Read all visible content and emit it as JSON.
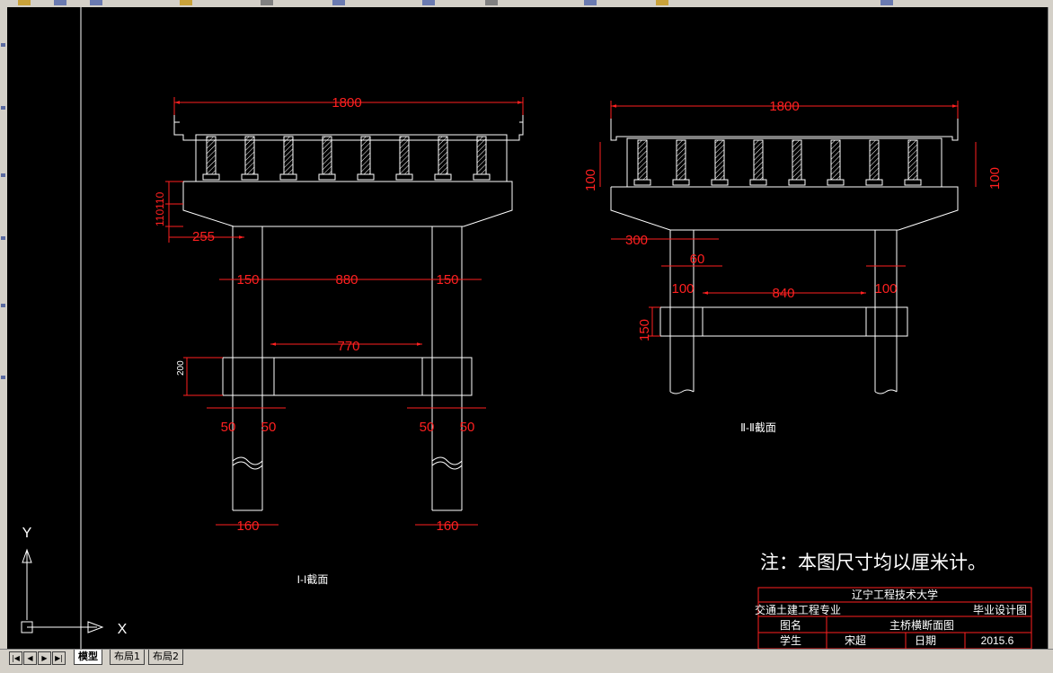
{
  "colors": {
    "canvas_bg": "#000000",
    "line": "#ffffff",
    "dimension": "#ff2020",
    "title_block_border": "#ff2020"
  },
  "tabs": {
    "nav": [
      "|◀",
      "◀",
      "▶",
      "▶|"
    ],
    "model": "模型",
    "layout1": "布局1",
    "layout2": "布局2"
  },
  "section1": {
    "title": "I-I截面",
    "dims": {
      "top_width": "1800",
      "cap_height": "110110",
      "overhang": "255",
      "col_left": "150",
      "col_gap": "880",
      "col_right": "150",
      "beam_gap": "770",
      "beam_height": "200",
      "beam_ext_a": "50",
      "beam_ext_b": "50",
      "beam_ext_c": "50",
      "beam_ext_d": "50",
      "pile_left": "160",
      "pile_right": "160"
    }
  },
  "section2": {
    "title": "Ⅱ-Ⅱ截面",
    "dims": {
      "top_width": "1800",
      "left_height": "100",
      "right_height": "100",
      "overhang": "300",
      "col_offset": "60",
      "col_left": "100",
      "col_gap": "840",
      "col_right": "100",
      "beam_height": "150"
    }
  },
  "note": "注：本图尺寸均以厘米计。",
  "title_block": {
    "school": "辽宁工程技术大学",
    "major": "交通土建工程专业",
    "doc_type": "毕业设计图",
    "name_label": "图名",
    "drawing_name": "主桥横断面图",
    "student_label": "学生",
    "student_name": "宋超",
    "date_label": "日期",
    "date_value": "2015.6"
  },
  "ucs": {
    "x_label": "X",
    "y_label": "Y"
  }
}
